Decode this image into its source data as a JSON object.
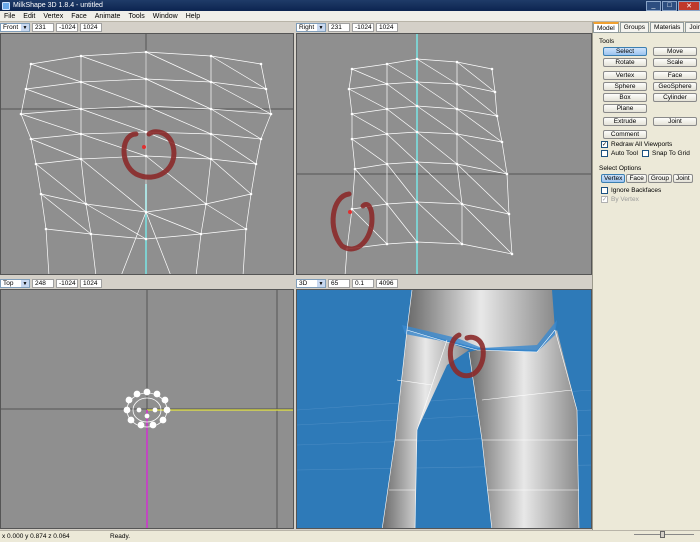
{
  "window": {
    "title": "MilkShape 3D 1.8.4 - untitled",
    "minimize": "_",
    "maximize": "□",
    "close": "✕"
  },
  "menu": [
    "File",
    "Edit",
    "Vertex",
    "Face",
    "Animate",
    "Tools",
    "Window",
    "Help"
  ],
  "viewports": {
    "front": {
      "view": "Front",
      "zoom": "231",
      "min": "-1024",
      "max": "1024"
    },
    "right": {
      "view": "Right",
      "zoom": "231",
      "min": "-1024",
      "max": "1024"
    },
    "top": {
      "view": "Top",
      "zoom": "248",
      "min": "-1024",
      "max": "1024"
    },
    "persp": {
      "view": "3D",
      "zoom": "65",
      "min": "0.1",
      "max": "4096"
    }
  },
  "panel": {
    "tabs": [
      "Model",
      "Groups",
      "Materials",
      "Joints"
    ],
    "active_tab": "Model",
    "tools_label": "Tools",
    "tools": [
      [
        "Select",
        "Move"
      ],
      [
        "Rotate",
        "Scale"
      ],
      [
        "Vertex",
        "Face"
      ],
      [
        "Sphere",
        "GeoSphere"
      ],
      [
        "Box",
        "Cylinder"
      ],
      [
        "Plane",
        ""
      ],
      [
        "Extrude",
        "Joint"
      ]
    ],
    "comment": "Comment",
    "redraw": "Redraw All Viewports",
    "auto_tool": "Auto Tool",
    "snap_grid": "Snap To Grid",
    "select_options_label": "Select Options",
    "select_modes": [
      "Vertex",
      "Face",
      "Group",
      "Joint"
    ],
    "ignore_backfaces": "Ignore Backfaces",
    "by_vertex": "By Vertex"
  },
  "status": {
    "coords": "x 0.000 y 0.874 z 0.064",
    "text": "Ready."
  },
  "colors": {
    "viewport_gray": "#8f8f8f",
    "viewport_blue": "#2e7ab8",
    "annotation": "#8b2a2a",
    "wire": "#ffffff"
  }
}
